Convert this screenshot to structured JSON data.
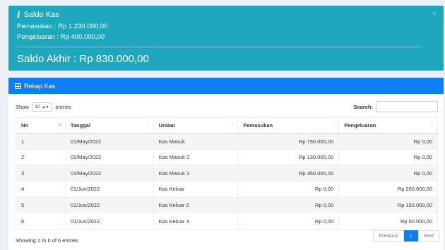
{
  "alert": {
    "close_label": "×",
    "title": "Saldo Kas",
    "pemasukan": "Pemasukan : Rp 1.230.000,00",
    "pengeluaran": "Pengeluaran : Rp 400.000,00",
    "saldo_akhir": "Saldo Akhir : Rp 830.000,00",
    "color": "#1ea7bd"
  },
  "panel": {
    "title": "Rekap Kas",
    "header_color": "#0d7ef5"
  },
  "controls": {
    "show_label": "Show",
    "page_size": "10",
    "entries_label": "entries",
    "search_label": "Search:",
    "search_value": ""
  },
  "table": {
    "columns": [
      "No",
      "Tanggal",
      "Uraian",
      "Pemasukan",
      "Pengeluaran"
    ],
    "rows": [
      [
        "1",
        "01/May/2022",
        "Kas Masuk",
        "Rp 750.000,00",
        "Rp 0,00"
      ],
      [
        "2",
        "02/May/2022",
        "Kas Masuk 2",
        "Rp 130.000,00",
        "Rp 0,00"
      ],
      [
        "3",
        "03/May/2022",
        "Kas Masuk 3",
        "Rp 350.000,00",
        "Rp 0,00"
      ],
      [
        "4",
        "01/Jun/2022",
        "Kas Keluar",
        "Rp 0,00",
        "Rp 200.000,00"
      ],
      [
        "5",
        "01/Jun/2022",
        "Kas Keluar 2",
        "Rp 0,00",
        "Rp 150.000,00"
      ],
      [
        "6",
        "01/Jun/2022",
        "Kas Keluar 3",
        "Rp 0,00",
        "Rp 50.000,00"
      ]
    ]
  },
  "footer": {
    "info": "Showing 1 to 6 of 6 entries",
    "previous": "Previous",
    "current_page": "1",
    "next": "Next"
  }
}
